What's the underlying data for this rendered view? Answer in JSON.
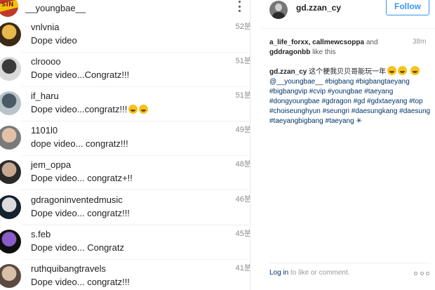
{
  "comments_panel": {
    "header_username": "__youngbae__",
    "header_avatar_text": "SIN",
    "comments": [
      {
        "username": "vnlvnia",
        "text": "Dope video",
        "time": "52분",
        "emojis": [],
        "avatar_colors": [
          "#3a2a16",
          "#e8b84a"
        ]
      },
      {
        "username": "clroooo",
        "text": "Dope video...Congratz!!!",
        "time": "51분",
        "emojis": [],
        "avatar_colors": [
          "#d9d9d9",
          "#3b3b3b"
        ]
      },
      {
        "username": "if_haru",
        "text": "Dope video...congratz!!!",
        "time": "51분",
        "emojis": [
          "grinning-face",
          "grinning-face"
        ],
        "avatar_colors": [
          "#b9c4c9",
          "#4a5a66"
        ]
      },
      {
        "username": "1101l0",
        "text": "dope video... congratz!!!",
        "time": "49분",
        "emojis": [],
        "avatar_colors": [
          "#7a7a7a",
          "#e1c2a6"
        ]
      },
      {
        "username": "jem_oppa",
        "text": "Dope video... congratz+!!",
        "time": "48분",
        "emojis": [],
        "avatar_colors": [
          "#2a2a2a",
          "#c8a890"
        ]
      },
      {
        "username": "gdragoninventedmusic",
        "text": "Dope video... congratz!!!",
        "time": "46분",
        "emojis": [],
        "avatar_colors": [
          "#15232e",
          "#dcdcdc"
        ]
      },
      {
        "username": "s.feb",
        "text": "Dope video... Congratz",
        "time": "45분",
        "emojis": [],
        "avatar_colors": [
          "#0f0f0f",
          "#8a5cc8"
        ]
      },
      {
        "username": "ruthquibangtravels",
        "text": "Dope video... congratz!!!",
        "time": "41분",
        "emojis": [],
        "avatar_colors": [
          "#5a4a40",
          "#d8c0a8"
        ]
      }
    ]
  },
  "post_panel": {
    "username": "gd.zzan_cy",
    "follow_label": "Follow",
    "likes": {
      "names": "a_life_forxx, callmewcsoppa",
      "and_label": "and",
      "last_name": "gddragonbb",
      "suffix": "like this",
      "time": "38m"
    },
    "caption": {
      "username": "gd.zzan_cy",
      "text": "这个梗我贝贝哥能玩一年",
      "mention": "@__youngbae__",
      "hashtags": [
        "#bigbang",
        "#bigbangtaeyang",
        "#bigbangvip",
        "#cvip",
        "#youngbae",
        "#taeyang",
        "#dongyoungbae",
        "#gdragon",
        "#gd",
        "#gdxtaeyang",
        "#top",
        "#choiseunghyun",
        "#seungri",
        "#daesungkang",
        "#daesung",
        "#taeyangbigbang",
        "#taeyang"
      ],
      "trailing_symbol": "✳"
    },
    "login_link": "Log in",
    "login_suffix": "to like or comment."
  },
  "colors": {
    "link": "#003569",
    "follow_blue": "#3897f0",
    "timestamp_gray": "#8a8a8a",
    "divider": "#efefef"
  }
}
